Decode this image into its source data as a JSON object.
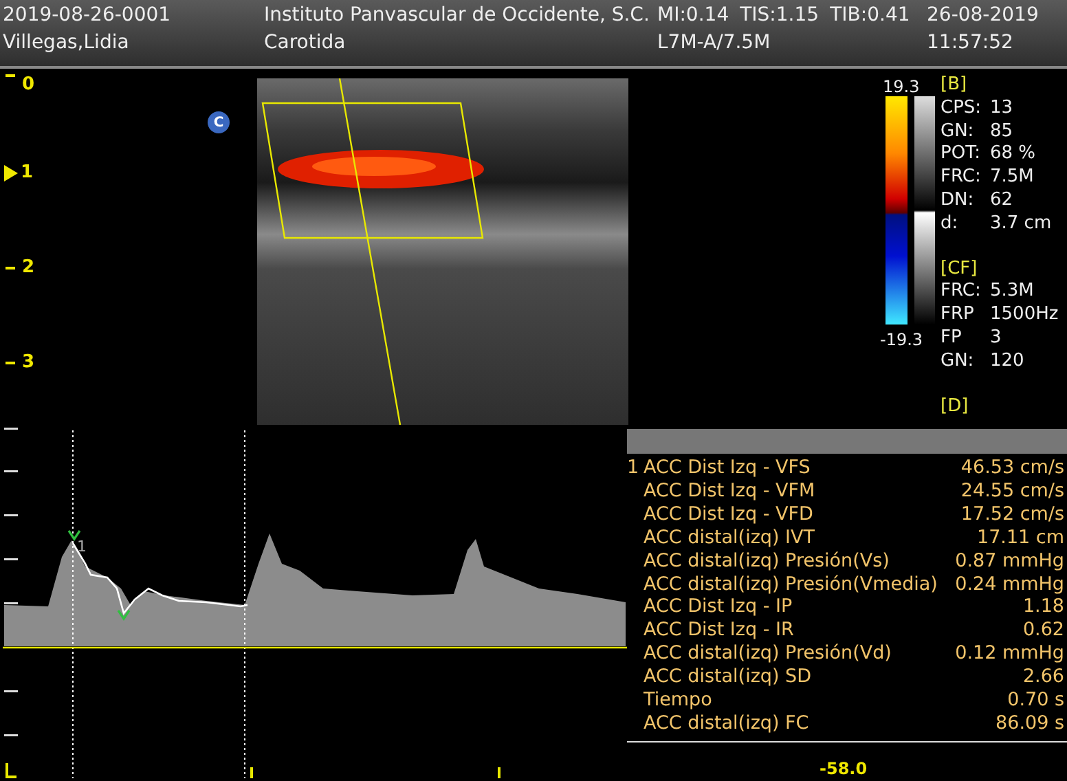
{
  "header": {
    "study_id": "2019-08-26-0001",
    "patient_name": "Villegas,Lidia",
    "institution": "Instituto Panvascular de Occidente, S.C.",
    "exam": "Carotida",
    "acoustic": [
      "MI:0.14",
      "TIS:1.15",
      "TIB:0.41"
    ],
    "probe": "L7M-A/7.5M",
    "date": "26-08-2019",
    "time": "11:57:52"
  },
  "depth_scale": [
    {
      "label": "0",
      "focus": false
    },
    {
      "label": "1",
      "focus": true
    },
    {
      "label": "2",
      "focus": false
    },
    {
      "label": "3",
      "focus": false
    }
  ],
  "mode_badge": "C",
  "color_scale": {
    "max": "19.3",
    "min": "-19.3"
  },
  "parameters": [
    {
      "title": "[B]",
      "rows": [
        {
          "name": "CPS:",
          "value": "13"
        },
        {
          "name": "GN:",
          "value": "85"
        },
        {
          "name": "POT:",
          "value": "68 %"
        },
        {
          "name": "FRC:",
          "value": "7.5M"
        },
        {
          "name": "DN:",
          "value": "62"
        },
        {
          "name": "d:",
          "value": "3.7 cm"
        }
      ]
    },
    {
      "title": "[CF]",
      "rows": [
        {
          "name": "FRC:",
          "value": "5.3M"
        },
        {
          "name": "FRP",
          "value": "1500Hz"
        },
        {
          "name": "FP",
          "value": "3"
        },
        {
          "name": "GN:",
          "value": "120"
        }
      ]
    },
    {
      "title": "[D]"
    }
  ],
  "spectrum": {
    "cursor_label": "1",
    "baseline_value": "-58.0"
  },
  "measurements": [
    {
      "index": "1",
      "name": "ACC Dist Izq - VFS",
      "value": "46.53 cm/s"
    },
    {
      "name": "ACC Dist Izq - VFM",
      "value": "24.55 cm/s"
    },
    {
      "name": "ACC Dist Izq - VFD",
      "value": "17.52 cm/s"
    },
    {
      "name": "ACC distal(izq) IVT",
      "value": "17.11 cm"
    },
    {
      "name": "ACC distal(izq) Presión(Vs)",
      "value": "0.87 mmHg"
    },
    {
      "name": "ACC distal(izq) Presión(Vmedia)",
      "value": "0.24 mmHg"
    },
    {
      "name": "ACC Dist Izq - IP",
      "value": "1.18"
    },
    {
      "name": "ACC Dist Izq - IR",
      "value": "0.62"
    },
    {
      "name": "ACC distal(izq) Presión(Vd)",
      "value": "0.12 mmHg"
    },
    {
      "name": "ACC distal(izq) SD",
      "value": "2.66"
    },
    {
      "name": "Tiempo",
      "value": "0.70 s"
    },
    {
      "name": "ACC distal(izq) FC",
      "value": "86.09 s"
    }
  ]
}
